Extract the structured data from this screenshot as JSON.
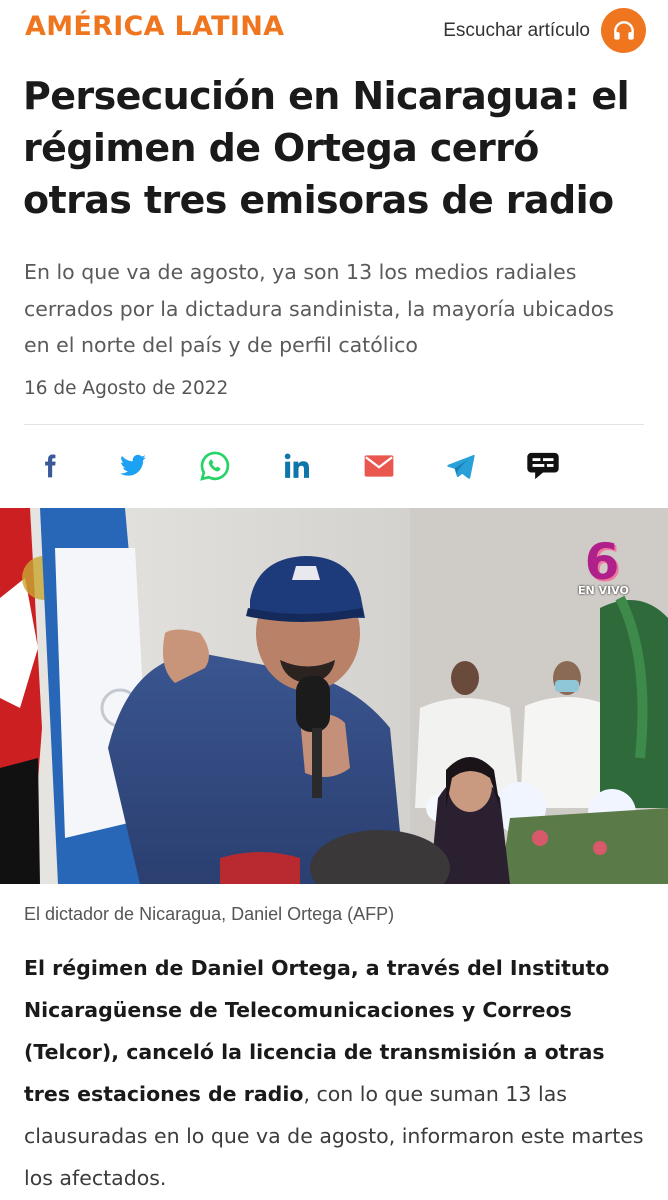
{
  "header": {
    "section": "AMÉRICA LATINA",
    "listen_label": "Escuchar artículo",
    "listen_icon": "headphones-icon",
    "accent_color": "#f0751f"
  },
  "article": {
    "headline": "Persecución en Nicaragua: el régimen de Ortega cerró otras tres emisoras de radio",
    "subheadline": "En lo que va de agosto, ya son 13 los medios radiales cerrados por la dictadura sandinista, la mayoría ubicados en el norte del país y de perfil católico",
    "date": "16 de Agosto de 2022",
    "image_caption": "El dictador de Nicaragua, Daniel Ortega (AFP)",
    "tv_logo_number": "6",
    "tv_logo_label": "EN VIVO",
    "body_bold": "El régimen de Daniel Ortega, a través del Instituto Nicaragüense de Telecomunicaciones y Correos (Telcor), canceló la licencia de transmisión a otras tres estaciones de radio",
    "body_rest": ", con lo que suman 13 las clausuradas en lo que va de agosto, informaron este martes los afectados."
  },
  "share": [
    {
      "name": "facebook-icon",
      "color": "#3b5998"
    },
    {
      "name": "twitter-icon",
      "color": "#1da1f2"
    },
    {
      "name": "whatsapp-icon",
      "color": "#25d366"
    },
    {
      "name": "linkedin-icon",
      "color": "#0e76a8"
    },
    {
      "name": "email-icon",
      "color": "#e9574e"
    },
    {
      "name": "telegram-icon",
      "color": "#2aa0d9"
    },
    {
      "name": "comments-icon",
      "color": "#111111"
    }
  ]
}
